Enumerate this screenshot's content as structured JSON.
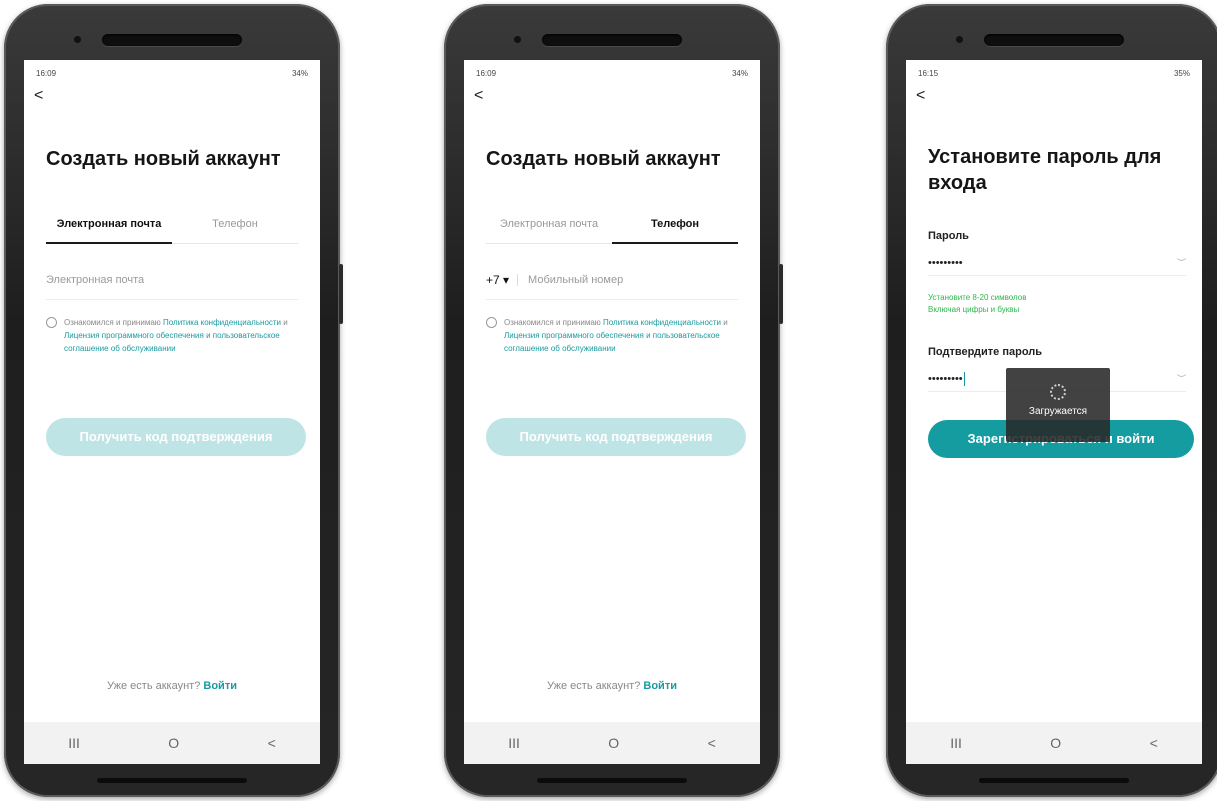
{
  "phone1": {
    "status_time": "16:09",
    "status_right": "34%",
    "back": "<",
    "title": "Создать новый аккаунт",
    "tabs": [
      "Электронная почта",
      "Телефон"
    ],
    "email_placeholder": "Электронная почта",
    "consent_plain1": "Ознакомился и принимаю ",
    "consent_link1": "Политика конфиденциальности",
    "consent_plain2": " и ",
    "consent_link2": "Лицензия программного обеспечения и пользовательское соглашение об обслуживании",
    "get_code_button": "Получить код подтверждения",
    "footer_text": "Уже есть аккаунт? ",
    "footer_login": "Войти",
    "nav": [
      "III",
      "O",
      "<"
    ]
  },
  "phone2": {
    "status_time": "16:09",
    "status_right": "34%",
    "back": "<",
    "title": "Создать новый аккаунт",
    "tabs": [
      "Электронная почта",
      "Телефон"
    ],
    "country_code": "+7 ▾",
    "phone_placeholder": "Мобильный номер",
    "consent_plain1": "Ознакомился и принимаю ",
    "consent_link1": "Политика конфиденциальности",
    "consent_plain2": " и ",
    "consent_link2": "Лицензия программного обеспечения и пользовательское соглашение об обслуживании",
    "get_code_button": "Получить код подтверждения",
    "footer_text": "Уже есть аккаунт? ",
    "footer_login": "Войти",
    "nav": [
      "III",
      "O",
      "<"
    ]
  },
  "phone3": {
    "status_time": "16:15",
    "status_right": "35%",
    "back": "<",
    "title": "Установите пароль для входа",
    "password_label": "Пароль",
    "password_value": "•••••••••",
    "hint_line1": "Установите 8-20 символов",
    "hint_line2": "Включая цифры и буквы",
    "confirm_label": "Подтвердите пароль",
    "confirm_value": "•••••••••",
    "register_button": "Зарегистрироваться и войти",
    "loading_text": "Загружается",
    "nav": [
      "III",
      "O",
      "<"
    ]
  },
  "colors": {
    "accent": "#1a9aa0",
    "button_disabled": "#bfe4e6",
    "button_active": "#159ca0",
    "hint_green": "#2cb84a"
  },
  "icons": [
    "back-chevron-icon",
    "radio-icon",
    "eye-icon",
    "spinner-icon",
    "recents-icon",
    "home-icon",
    "back-nav-icon"
  ]
}
